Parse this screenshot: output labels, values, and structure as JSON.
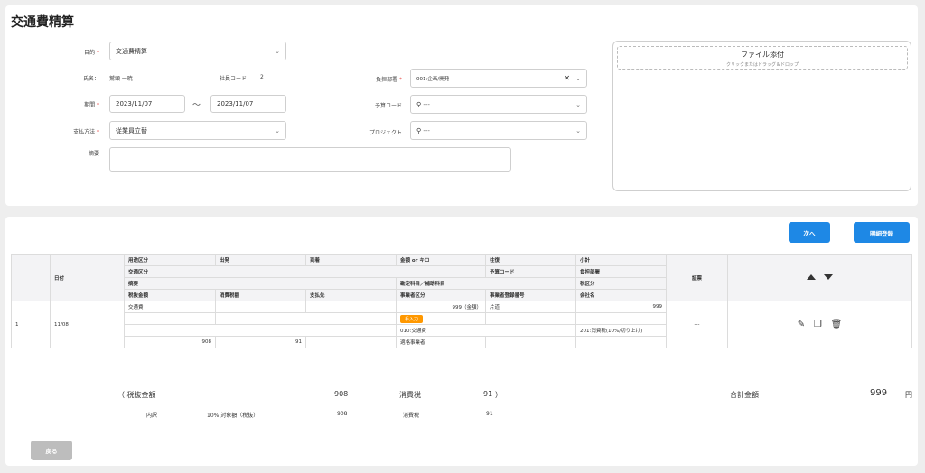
{
  "page": {
    "title": "交通費精算"
  },
  "form": {
    "purpose": {
      "label": "目的",
      "value": "交通費精算"
    },
    "name": {
      "label": "氏名：",
      "value": "鷲頭 一暁"
    },
    "emp_code": {
      "label": "社員コード：",
      "value": "2"
    },
    "period": {
      "label": "期間",
      "from": "2023/11/07",
      "sep": "～",
      "to": "2023/11/07"
    },
    "payment": {
      "label": "支払方法",
      "value": "従業員立替"
    },
    "summary": {
      "label": "摘要",
      "value": ""
    },
    "dept": {
      "label": "負担部署",
      "value": "001:企画/開発"
    },
    "budget": {
      "label": "予算コード",
      "value": "---"
    },
    "project": {
      "label": "プロジェクト",
      "value": "---"
    },
    "required_mark": "*"
  },
  "upload": {
    "title": "ファイル添付",
    "hint": "クリックまたはドラッグ＆ドロップ"
  },
  "actions": {
    "next": "次へ",
    "register": "明細登録",
    "back": "戻る"
  },
  "table": {
    "header": {
      "date": "日付",
      "purpose_cat": "用途区分",
      "from": "出発",
      "to": "到着",
      "amount": "金額 or キロ",
      "roundtrip": "往復",
      "subtotal": "小計",
      "transport": "交通区分",
      "budget": "予算コード",
      "dept": "負担部署",
      "memo": "摘要",
      "account": "勘定科目／補助科目",
      "tax_cat": "税区分",
      "pretax": "税抜金額",
      "tax": "消費税額",
      "payee": "支払先",
      "biz_cat": "事業者区分",
      "biz_reg": "事業者登録番号",
      "company": "会社名",
      "evidence": "証票"
    },
    "row": {
      "no": "1",
      "date": "11/08",
      "purpose_cat": "交通費",
      "amount": "999（金額）",
      "roundtrip": "片道",
      "subtotal": "999",
      "badge": "手入力",
      "account": "010:交通費",
      "tax_cat": "201:消費税(10%/切り上げ)",
      "pretax": "908",
      "tax": "91",
      "biz_cat": "適格事業者",
      "evidence": "---"
    }
  },
  "totals": {
    "open": "（ 税抜金額",
    "pretax": "908",
    "tax_label": "消費税",
    "tax": "91",
    "close": "）",
    "total_label": "合計金額",
    "total": "999",
    "yen": "円",
    "breakdown": "内訳",
    "rate_label": "10% 対象額（税抜）",
    "rate_pretax": "908",
    "rate_tax_label": "消費税",
    "rate_tax": "91"
  }
}
